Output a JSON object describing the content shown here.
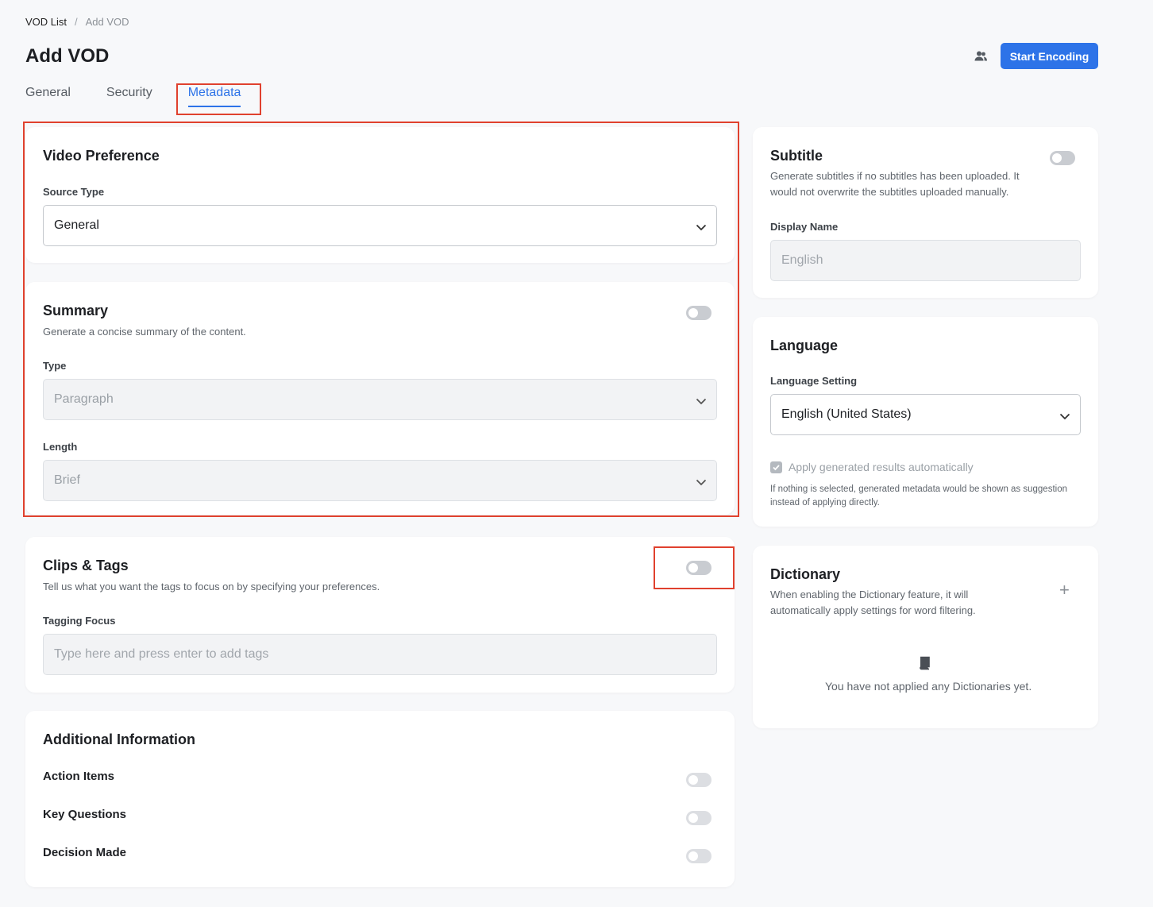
{
  "breadcrumb": {
    "parent": "VOD List",
    "separator": "/",
    "current": "Add VOD"
  },
  "page_title": "Add VOD",
  "header": {
    "users_icon": "users-icon",
    "start_button": "Start Encoding"
  },
  "tabs": [
    {
      "label": "General",
      "active": false
    },
    {
      "label": "Security",
      "active": false
    },
    {
      "label": "Metadata",
      "active": true
    }
  ],
  "video_preference": {
    "title": "Video Preference",
    "source_type_label": "Source Type",
    "source_type_value": "General"
  },
  "summary": {
    "title": "Summary",
    "description": "Generate a concise summary of the content.",
    "enabled": false,
    "type_label": "Type",
    "type_value": "Paragraph",
    "length_label": "Length",
    "length_value": "Brief"
  },
  "clips_tags": {
    "title": "Clips & Tags",
    "description": "Tell us what you want the tags to focus on by specifying your preferences.",
    "enabled": false,
    "tagging_focus_label": "Tagging Focus",
    "tagging_focus_placeholder": "Type here and press enter to add tags"
  },
  "additional_info": {
    "title": "Additional Information",
    "items": [
      {
        "label": "Action Items",
        "enabled": false
      },
      {
        "label": "Key Questions",
        "enabled": false
      },
      {
        "label": "Decision Made",
        "enabled": false
      }
    ]
  },
  "subtitle": {
    "title": "Subtitle",
    "description": "Generate subtitles if no subtitles has been uploaded. It would not overwrite the subtitles uploaded manually.",
    "enabled": false,
    "display_name_label": "Display Name",
    "display_name_placeholder": "English"
  },
  "language": {
    "title": "Language",
    "setting_label": "Language Setting",
    "setting_value": "English (United States)",
    "apply_auto_label": "Apply generated results automatically",
    "apply_auto_checked": true,
    "note": "If nothing is selected, generated metadata would be shown as suggestion instead of applying directly."
  },
  "dictionary": {
    "title": "Dictionary",
    "description": "When enabling the Dictionary feature, it will automatically apply settings for word filtering.",
    "empty_text": "You have not applied any Dictionaries yet."
  },
  "colors": {
    "accent": "#2d73e8",
    "annotation": "#e0412e"
  }
}
